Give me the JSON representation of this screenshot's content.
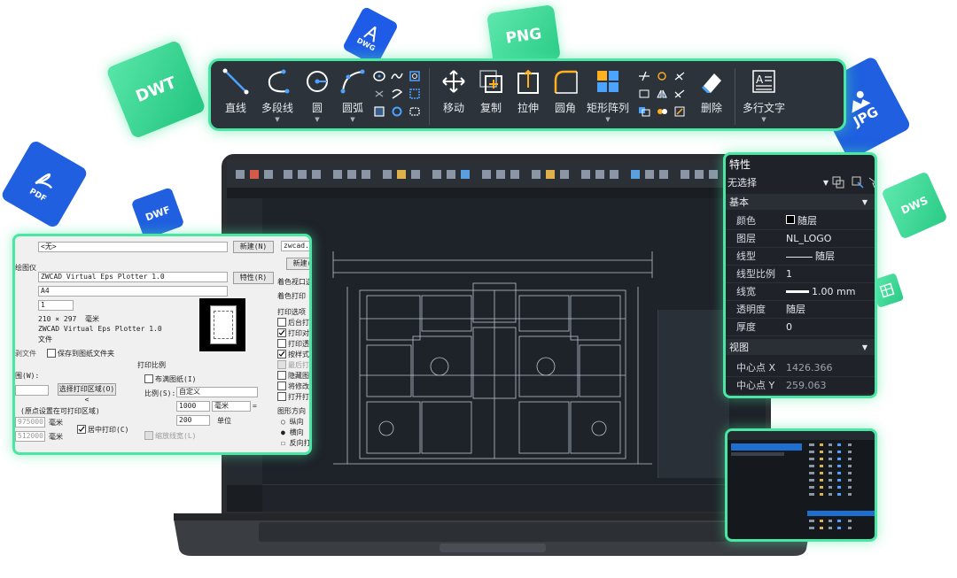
{
  "badges": {
    "dwt": "DWT",
    "dwg": "DWG",
    "png": "PNG",
    "pdf": "PDF",
    "dwf": "DWF",
    "jpg": "JPG",
    "dws": "DWS"
  },
  "ribbon": {
    "line": "直线",
    "polyline": "多段线",
    "circle": "圆",
    "arc": "圆弧",
    "move": "移动",
    "copy": "复制",
    "stretch": "拉伸",
    "fillet": "圆角",
    "rect_array": "矩形阵列",
    "erase": "删除",
    "mtext": "多行文字"
  },
  "print_dialog": {
    "page_setup_value": "<无>",
    "new_button": "新建(N)",
    "new_button2": "新建(",
    "zwcad_tab": "zwcad.c",
    "printer_label": "绘图仪",
    "printer_value": "ZWCAD Virtual Eps Plotter 1.0",
    "properties_button": "特性(R)",
    "paper_value": "A4",
    "copies_value": "1",
    "size_value": "210 × 297",
    "size_unit": "毫米",
    "plotter_name": "ZWCAD Virtual Eps Plotter 1.0",
    "plotter_file": "文件",
    "save_file_label": "保存到图纸文件夹",
    "file_prefix": "到文件",
    "scale_section": "打印比例",
    "fit_paper": "布满图纸(I)",
    "scale_label": "比例(S):",
    "scale_value": "自定义",
    "area_label": "范围(W):",
    "select_area_button": "选择打印区域(O)<",
    "scale_num": "1000",
    "scale_unit": "毫米",
    "scale_den": "200",
    "scale_den_unit": "单位",
    "offset_note": "(原点设置在可打印区域)",
    "offset_x": "975000",
    "offset_x_unit": "毫米",
    "offset_y": "512000",
    "offset_y_unit": "毫米",
    "center_print": "居中打印(C)",
    "scale_lineweights": "缩放线宽(L)",
    "color_viewport": "着色视口选项",
    "shade_print": "着色打印",
    "print_options": "打印选项",
    "opt1": "后台打印",
    "opt2": "打印对象",
    "opt3": "打印透明",
    "opt4": "按样式打",
    "opt5": "最后打印",
    "opt6": "隐藏图纸",
    "opt7": "将修改保",
    "opt8": "打开打印",
    "orientation": "图形方向",
    "portrait": "纵向",
    "landscape": "横向",
    "reverse": "反向打印",
    "file_label": "剥文件",
    "range_small": "围(W):"
  },
  "properties": {
    "title": "特性",
    "selection": "无选择",
    "section_basic": "基本",
    "color_k": "颜色",
    "color_v": "随层",
    "layer_k": "图层",
    "layer_v": "NL_LOGO",
    "linetype_k": "线型",
    "linetype_v": "随层",
    "ltscale_k": "线型比例",
    "ltscale_v": "1",
    "lineweight_k": "线宽",
    "lineweight_v": "1.00 mm",
    "transparency_k": "透明度",
    "transparency_v": "随层",
    "thickness_k": "厚度",
    "thickness_v": "0",
    "section_view": "视图",
    "cx_k": "中心点 X",
    "cx_v": "1426.366",
    "cy_k": "中心点 Y",
    "cy_v": "259.063"
  },
  "colors": {
    "accent": "#49e7a3",
    "badge_green": "#2fd18a",
    "badge_blue": "#1f5fe0",
    "panel_dark": "#1f2329",
    "ribbon_bg": "#2c333b"
  }
}
